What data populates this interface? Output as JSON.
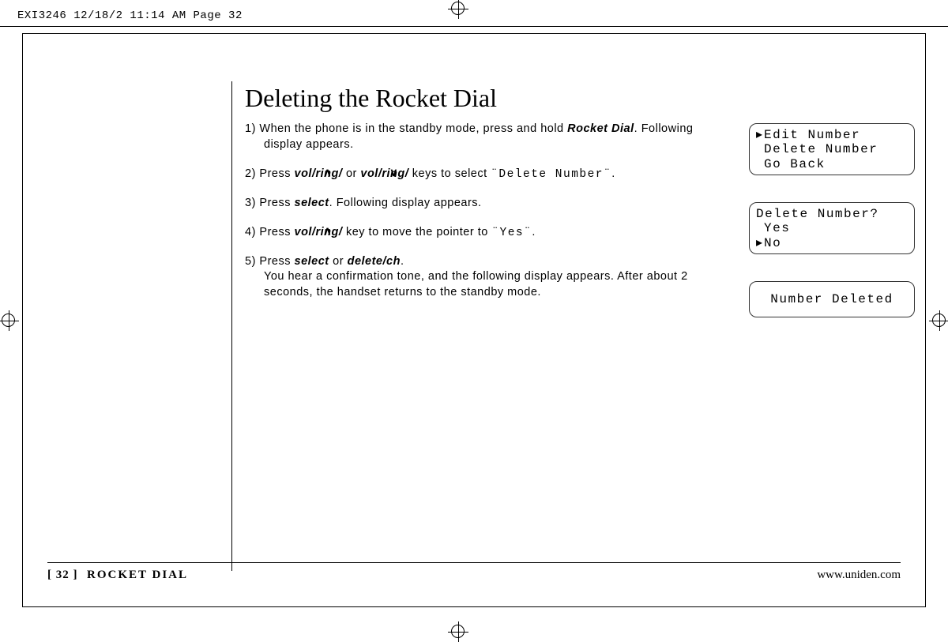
{
  "header": "EXI3246  12/18/2 11:14 AM  Page 32",
  "title": "Deleting the Rocket Dial",
  "steps": {
    "s1a": "1) When the phone is in the standby mode, press and hold ",
    "s1b": "Rocket Dial",
    "s1c": ". Following display appears.",
    "s2a": "2) Press ",
    "s2b": "vol/ring/",
    "s2c": " or ",
    "s2d": "vol/ring/",
    "s2e": " keys to select ",
    "s2f": "¨Delete Number¨",
    "s2g": ".",
    "s3a": "3) Press ",
    "s3b": "select",
    "s3c": ". Following display appears.",
    "s4a": "4) Press ",
    "s4b": "vol/ring/",
    "s4c": " key to move the pointer to ",
    "s4d": "¨Yes¨",
    "s4e": ".",
    "s5a": "5) Press ",
    "s5b": "select",
    "s5c": " or ",
    "s5d": "delete/ch",
    "s5e": ".",
    "s5f": "You hear a confirmation tone, and the following display appears. After about 2 seconds, the handset returns to the standby mode."
  },
  "lcd1": {
    "l1": "Edit Number",
    "l2": "Delete Number",
    "l3": "Go Back"
  },
  "lcd2": {
    "l1": "Delete Number?",
    "l2": "Yes",
    "l3": "No"
  },
  "lcd3": "Number Deleted",
  "footer": {
    "page": "[ 32 ]",
    "section": "ROCKET DIAL",
    "url": "www.uniden.com"
  }
}
